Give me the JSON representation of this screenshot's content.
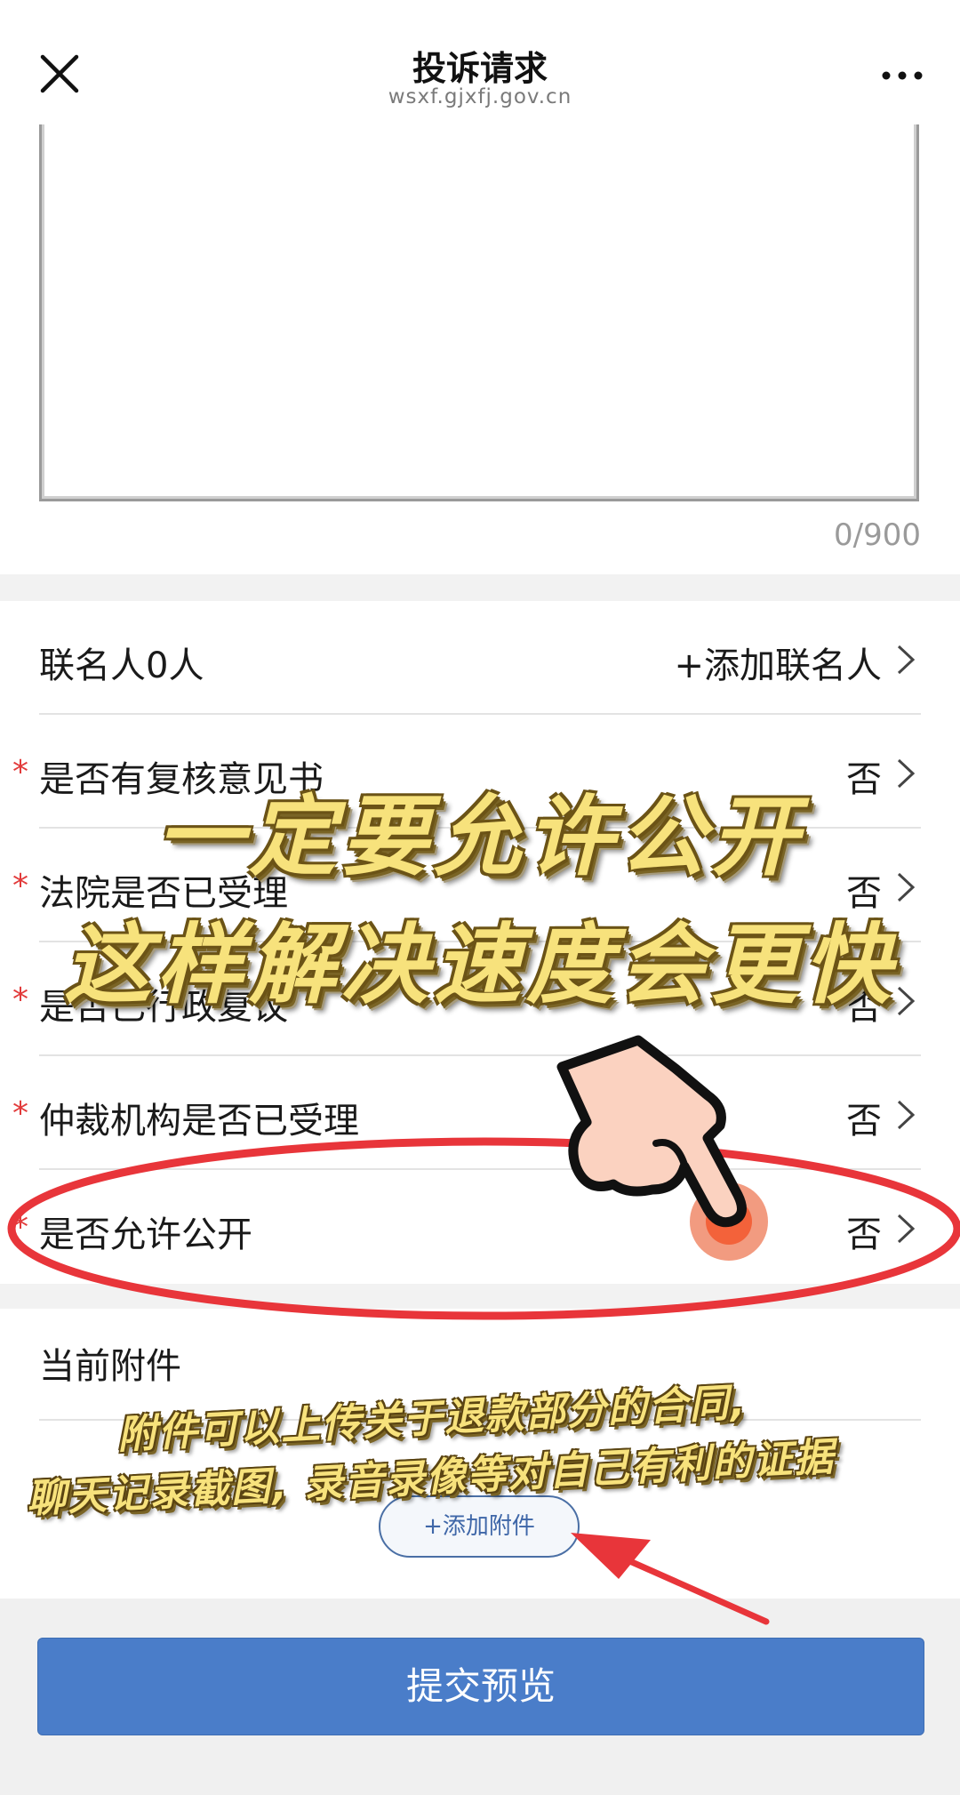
{
  "header": {
    "title": "投诉请求",
    "subtitle": "wsxf.gjxfj.gov.cn"
  },
  "complaint": {
    "char_counter": "0/900"
  },
  "rows": [
    {
      "label": "联名人0人",
      "value": "+添加联名人",
      "required": false
    },
    {
      "label": "是否有复核意见书",
      "value": "否",
      "required": true
    },
    {
      "label": "法院是否已受理",
      "value": "否",
      "required": true
    },
    {
      "label": "是否已行政复议",
      "value": "否",
      "required": true
    },
    {
      "label": "仲裁机构是否已受理",
      "value": "否",
      "required": true
    },
    {
      "label": "是否允许公开",
      "value": "否",
      "required": true
    }
  ],
  "required_mark": "*",
  "attachments": {
    "label": "当前附件",
    "add_button": "+添加附件"
  },
  "submit_button": "提交预览",
  "annotations": {
    "headline_line1": "一定要允许公开",
    "headline_line2": "这样解决速度会更快",
    "note_line1": "附件可以上传关于退款部分的合同,",
    "note_line2": "聊天记录截图, 录音录像等对自己有利的证据"
  },
  "icons": {
    "close": "close-icon",
    "more": "more-dots-icon",
    "chevron": "chevron-right-icon",
    "pointing_hand": "pointing-hand-icon",
    "arrow": "red-arrow-icon"
  },
  "colors": {
    "required_star": "#e23b3b",
    "submit_bg": "#4a7dc9",
    "annotation_red": "#e8353a",
    "annotation_yellow": "#f7e27c"
  }
}
